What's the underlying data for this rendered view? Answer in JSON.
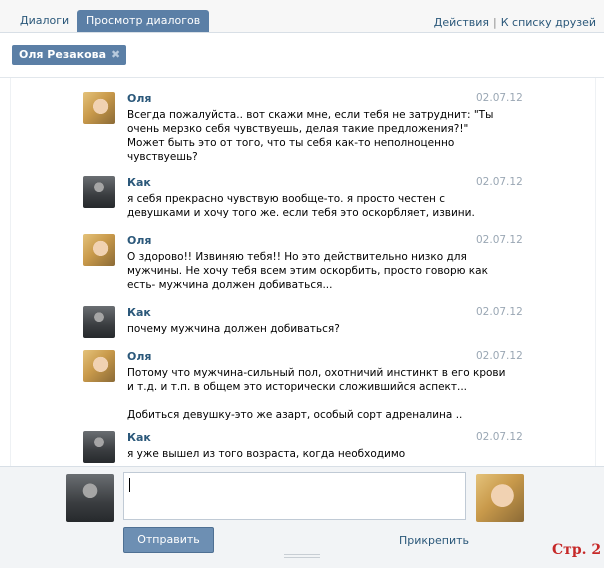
{
  "tabs": {
    "dialogs": "Диалоги",
    "view_dialogs": "Просмотр диалогов"
  },
  "header_links": {
    "actions": "Действия",
    "separator": "|",
    "to_friends": "К списку друзей"
  },
  "recipient": {
    "name": "Оля Резакова",
    "remove_icon": "close-icon"
  },
  "messages": [
    {
      "author": "Оля",
      "avatar": "avatar-olya",
      "date": "02.07.12",
      "lines": [
        "Всегда пожалуйста.. вот скажи мне, если тебя не затруднит: \"Ты",
        "очень мерзко себя чувствуешь, делая такие предложения?!\"",
        "Может быть это от того, что ты себя как-то неполноценно",
        "чувствуешь?"
      ]
    },
    {
      "author": "Как",
      "avatar": "avatar-kak",
      "date": "02.07.12",
      "lines": [
        "я себя прекрасно чувствую вообще-то. я просто честен с",
        "девушками и хочу того же. если тебя это оскорбляет, извини."
      ]
    },
    {
      "author": "Оля",
      "avatar": "avatar-olya",
      "date": "02.07.12",
      "lines": [
        "О здорово!! Извиняю тебя!! Но это действительно низко для",
        "мужчины. Не хочу тебя всем этим оскорбить, просто говорю как",
        "есть- мужчина должен добиваться..."
      ]
    },
    {
      "author": "Как",
      "avatar": "avatar-kak",
      "date": "02.07.12",
      "lines": [
        "почему мужчина должен добиваться?"
      ]
    },
    {
      "author": "Оля",
      "avatar": "avatar-olya",
      "date": "02.07.12",
      "lines": [
        "Потому что мужчина-сильный пол, охотничий инстинкт в его крови",
        "и т.д. и т.п. в общем это исторически сложившийся аспект...",
        "",
        "Добиться девушку-это же азарт, особый сорт адреналина .."
      ]
    },
    {
      "author": "Как",
      "avatar": "avatar-kak",
      "date": "02.07.12",
      "lines": [
        "я уже вышел из того возраста, когда необходимо"
      ]
    }
  ],
  "composer": {
    "input_value": "",
    "send_label": "Отправить",
    "attach_label": "Прикрепить"
  },
  "page_mark": "Стр. 2"
}
